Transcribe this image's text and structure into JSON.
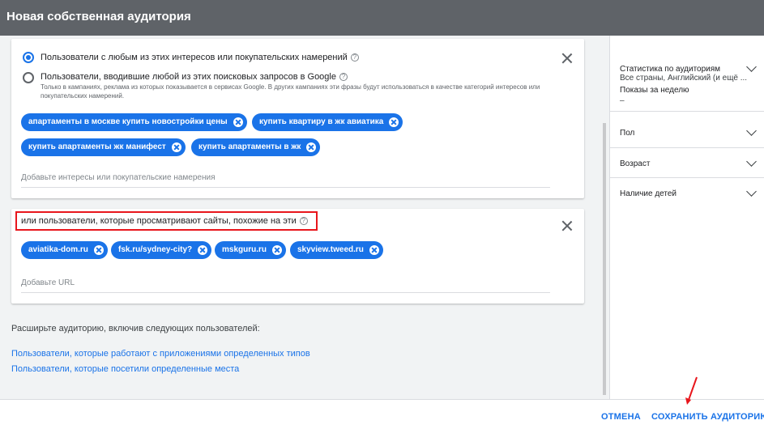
{
  "header": {
    "title": "Новая собственная аудитория"
  },
  "interests": {
    "option_any": "Пользователи с любым из этих интересов или покупательских намерений",
    "option_search": "Пользователи, вводившие любой из этих поисковых запросов в Google",
    "option_search_note": "Только в кампаниях, реклама из которых показывается в сервисах Google. В других кампаниях эти фразы будут использоваться в качестве категорий интересов или покупательских намерений.",
    "chips": [
      "апартаменты в москве купить новостройки цены",
      "купить квартиру в жк авиатика",
      "купить апартаменты жк манифест",
      "купить апартаменты в жк"
    ],
    "input_placeholder": "Добавьте интересы или покупательские намерения",
    "selected_option": "option_any"
  },
  "urls": {
    "label": "или пользователи, которые просматривают сайты, похожие на эти",
    "chips": [
      "aviatika-dom.ru",
      "fsk.ru/sydney-city?",
      "mskguru.ru",
      "skyview.tweed.ru"
    ],
    "input_placeholder": "Добавьте URL"
  },
  "expand": {
    "text": "Расширьте аудиторию, включив следующих пользователей:",
    "link_apps": "Пользователи, которые работают с приложениями определенных типов",
    "link_places": "Пользователи, которые посетили определенные места"
  },
  "sidebar": {
    "stats_title": "Статистика по аудиториям",
    "stats_sub": "Все страны, Английский (и ещё ...",
    "impressions_label": "Показы за неделю",
    "impressions_value": "–",
    "gender": "Пол",
    "age": "Возраст",
    "children": "Наличие детей"
  },
  "footer": {
    "cancel": "ОТМЕНА",
    "save": "СОХРАНИТЬ АУДИТОРИЮ"
  },
  "colors": {
    "accent": "#1a73e8",
    "header": "#5f6368",
    "highlight": "#e8161c"
  },
  "icons": [
    "help-icon",
    "close-icon",
    "chip-remove-icon",
    "chevron-down-icon",
    "red-arrow-annotation"
  ]
}
